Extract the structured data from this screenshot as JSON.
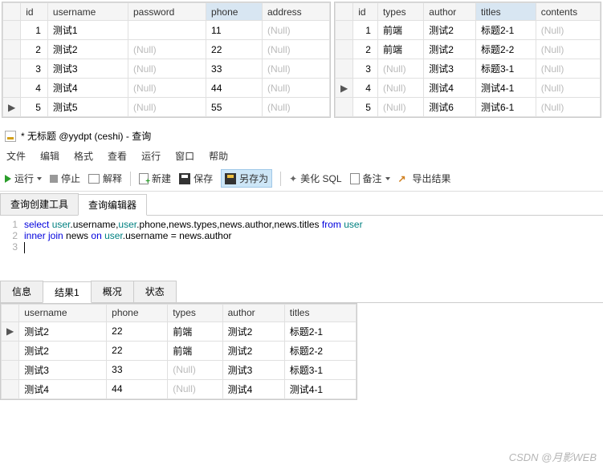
{
  "tables": {
    "left": {
      "cols": [
        "id",
        "username",
        "password",
        "phone",
        "address"
      ],
      "focus_col": 3,
      "rows": [
        {
          "marker": "",
          "id": "1",
          "username": "测试1",
          "password": "",
          "phone": "11",
          "address": "(Null)"
        },
        {
          "marker": "",
          "id": "2",
          "username": "测试2",
          "password": "(Null)",
          "phone": "22",
          "address": "(Null)"
        },
        {
          "marker": "",
          "id": "3",
          "username": "测试3",
          "password": "(Null)",
          "phone": "33",
          "address": "(Null)"
        },
        {
          "marker": "",
          "id": "4",
          "username": "测试4",
          "password": "(Null)",
          "phone": "44",
          "address": "(Null)"
        },
        {
          "marker": "▶",
          "id": "5",
          "username": "测试5",
          "password": "(Null)",
          "phone": "55",
          "address": "(Null)"
        }
      ]
    },
    "right": {
      "cols": [
        "id",
        "types",
        "author",
        "titles",
        "contents"
      ],
      "focus_col": 3,
      "rows": [
        {
          "marker": "",
          "id": "1",
          "types": "前端",
          "author": "测试2",
          "titles": "标题2-1",
          "contents": "(Null)"
        },
        {
          "marker": "",
          "id": "2",
          "types": "前端",
          "author": "测试2",
          "titles": "标题2-2",
          "contents": "(Null)"
        },
        {
          "marker": "",
          "id": "3",
          "types": "(Null)",
          "author": "测试3",
          "titles": "标题3-1",
          "contents": "(Null)"
        },
        {
          "marker": "▶",
          "id": "4",
          "types": "(Null)",
          "author": "测试4",
          "titles": "测试4-1",
          "contents": "(Null)"
        },
        {
          "marker": "",
          "id": "5",
          "types": "(Null)",
          "author": "测试6",
          "titles": "测试6-1",
          "contents": "(Null)"
        }
      ]
    }
  },
  "window_title": "* 无标题 @yydpt (ceshi) - 查询",
  "menu": [
    "文件",
    "编辑",
    "格式",
    "查看",
    "运行",
    "窗口",
    "帮助"
  ],
  "toolbar": {
    "run": "运行",
    "stop": "停止",
    "explain": "解释",
    "new": "新建",
    "save": "保存",
    "saveas": "另存为",
    "beautify": "美化 SQL",
    "note": "备注",
    "export": "导出结果"
  },
  "editor_tabs": {
    "builder": "查询创建工具",
    "editor": "查询编辑器",
    "active": 1
  },
  "sql": [
    {
      "n": "1",
      "parts": [
        {
          "t": "select ",
          "c": "kw"
        },
        {
          "t": "user",
          "c": "ident"
        },
        {
          "t": ".username,"
        },
        {
          "t": "user",
          "c": "ident"
        },
        {
          "t": ".phone,news.types,news.author,news.titles "
        },
        {
          "t": "from ",
          "c": "kw"
        },
        {
          "t": "user",
          "c": "ident"
        }
      ]
    },
    {
      "n": "2",
      "parts": [
        {
          "t": "inner join ",
          "c": "kw"
        },
        {
          "t": "news "
        },
        {
          "t": "on ",
          "c": "kw"
        },
        {
          "t": "user",
          "c": "ident"
        },
        {
          "t": ".username = news.author"
        }
      ]
    },
    {
      "n": "3",
      "parts": [],
      "cursor": true
    }
  ],
  "result_tabs": {
    "items": [
      "信息",
      "结果1",
      "概况",
      "状态"
    ],
    "active": 1
  },
  "results": {
    "cols": [
      "username",
      "phone",
      "types",
      "author",
      "titles"
    ],
    "rows": [
      {
        "marker": "▶",
        "username": "测试2",
        "phone": "22",
        "types": "前端",
        "author": "测试2",
        "titles": "标题2-1"
      },
      {
        "marker": "",
        "username": "测试2",
        "phone": "22",
        "types": "前端",
        "author": "测试2",
        "titles": "标题2-2"
      },
      {
        "marker": "",
        "username": "测试3",
        "phone": "33",
        "types": "(Null)",
        "author": "测试3",
        "titles": "标题3-1"
      },
      {
        "marker": "",
        "username": "测试4",
        "phone": "44",
        "types": "(Null)",
        "author": "测试4",
        "titles": "测试4-1"
      }
    ]
  },
  "watermark": "CSDN @月影WEB"
}
